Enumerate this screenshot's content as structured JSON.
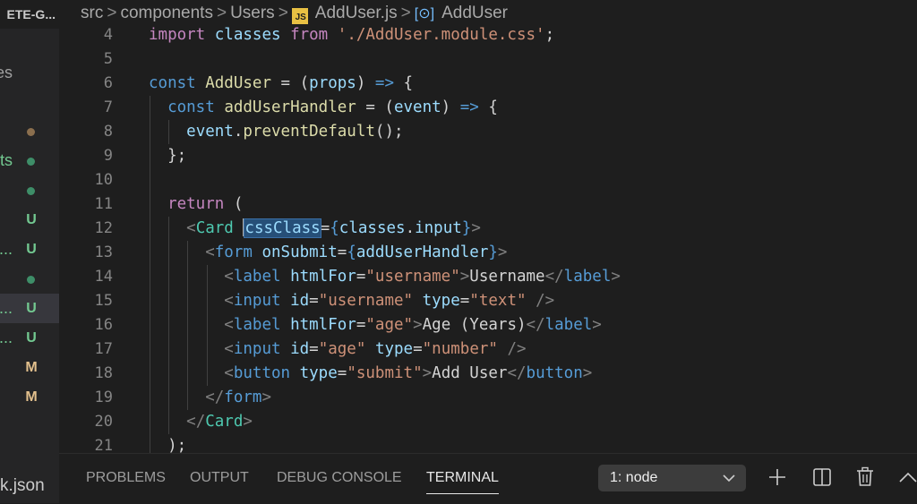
{
  "sidebar": {
    "title": "ETE-G...",
    "items": [
      {
        "name": "es",
        "badge": "",
        "dot": ""
      },
      {
        "name": "",
        "badge": "",
        "dot": "#8b6f4e"
      },
      {
        "name": "ts",
        "badge": "",
        "dot": "#3e8e68"
      },
      {
        "name": "",
        "badge": "",
        "dot": "#3e8e68"
      },
      {
        "name": "",
        "badge": "U",
        "dot": ""
      },
      {
        "name": "o...",
        "badge": "U",
        "dot": ""
      },
      {
        "name": "",
        "badge": "",
        "dot": "#3e8e68"
      },
      {
        "name": "r...",
        "badge": "U",
        "dot": ""
      },
      {
        "name": "r...",
        "badge": "U",
        "dot": ""
      },
      {
        "name": "",
        "badge": "M",
        "dot": ""
      },
      {
        "name": "",
        "badge": "M",
        "dot": ""
      }
    ],
    "bottom_item": "k.json"
  },
  "breadcrumb": {
    "segments": [
      "src",
      "components",
      "Users"
    ],
    "file": "AddUser.js",
    "file_icon": "JS",
    "symbol": "AddUser",
    "separator": ">"
  },
  "editor": {
    "lines": [
      {
        "n": "4",
        "indent": 0,
        "tokens": [
          [
            "kw",
            "import"
          ],
          [
            "pl",
            " "
          ],
          [
            "vr",
            "classes"
          ],
          [
            "pl",
            " "
          ],
          [
            "kw",
            "from"
          ],
          [
            "pl",
            " "
          ],
          [
            "st",
            "'./AddUser.module.css'"
          ],
          [
            "pl",
            ";"
          ]
        ]
      },
      {
        "n": "5",
        "indent": 0,
        "tokens": []
      },
      {
        "n": "6",
        "indent": 0,
        "tokens": [
          [
            "kb",
            "const"
          ],
          [
            "pl",
            " "
          ],
          [
            "fn",
            "AddUser"
          ],
          [
            "pl",
            " = ("
          ],
          [
            "vr",
            "props"
          ],
          [
            "pl",
            ") "
          ],
          [
            "kb",
            "=>"
          ],
          [
            "pl",
            " {"
          ]
        ]
      },
      {
        "n": "7",
        "indent": 1,
        "tokens": [
          [
            "pl",
            "  "
          ],
          [
            "kb",
            "const"
          ],
          [
            "pl",
            " "
          ],
          [
            "fn",
            "addUserHandler"
          ],
          [
            "pl",
            " = ("
          ],
          [
            "vr",
            "event"
          ],
          [
            "pl",
            ") "
          ],
          [
            "kb",
            "=>"
          ],
          [
            "pl",
            " {"
          ]
        ]
      },
      {
        "n": "8",
        "indent": 2,
        "tokens": [
          [
            "pl",
            "    "
          ],
          [
            "vr",
            "event"
          ],
          [
            "pl",
            "."
          ],
          [
            "fn",
            "preventDefault"
          ],
          [
            "pl",
            "();"
          ]
        ]
      },
      {
        "n": "9",
        "indent": 1,
        "tokens": [
          [
            "pl",
            "  };"
          ]
        ]
      },
      {
        "n": "10",
        "indent": 1,
        "tokens": []
      },
      {
        "n": "11",
        "indent": 1,
        "tokens": [
          [
            "pl",
            "  "
          ],
          [
            "kw",
            "return"
          ],
          [
            "pl",
            " ("
          ]
        ]
      },
      {
        "n": "12",
        "indent": 2,
        "tokens": [
          [
            "pl",
            "    "
          ],
          [
            "br",
            "<"
          ],
          [
            "cp",
            "Card"
          ],
          [
            "pl",
            " "
          ],
          [
            "cur",
            ""
          ],
          [
            "sel",
            "cssClass"
          ],
          [
            "pl",
            "="
          ],
          [
            "kb",
            "{"
          ],
          [
            "vr",
            "classes"
          ],
          [
            "pl",
            "."
          ],
          [
            "vr",
            "input"
          ],
          [
            "kb",
            "}"
          ],
          [
            "br",
            ">"
          ]
        ]
      },
      {
        "n": "13",
        "indent": 3,
        "tokens": [
          [
            "pl",
            "      "
          ],
          [
            "br",
            "<"
          ],
          [
            "tg",
            "form"
          ],
          [
            "pl",
            " "
          ],
          [
            "vr",
            "onSubmit"
          ],
          [
            "pl",
            "="
          ],
          [
            "kb",
            "{"
          ],
          [
            "vr",
            "addUserHandler"
          ],
          [
            "kb",
            "}"
          ],
          [
            "br",
            ">"
          ]
        ]
      },
      {
        "n": "14",
        "indent": 4,
        "tokens": [
          [
            "pl",
            "        "
          ],
          [
            "br",
            "<"
          ],
          [
            "tg",
            "label"
          ],
          [
            "pl",
            " "
          ],
          [
            "vr",
            "htmlFor"
          ],
          [
            "pl",
            "="
          ],
          [
            "st",
            "\"username\""
          ],
          [
            "br",
            ">"
          ],
          [
            "pl",
            "Username"
          ],
          [
            "br",
            "</"
          ],
          [
            "tg",
            "label"
          ],
          [
            "br",
            ">"
          ]
        ]
      },
      {
        "n": "15",
        "indent": 4,
        "tokens": [
          [
            "pl",
            "        "
          ],
          [
            "br",
            "<"
          ],
          [
            "tg",
            "input"
          ],
          [
            "pl",
            " "
          ],
          [
            "vr",
            "id"
          ],
          [
            "pl",
            "="
          ],
          [
            "st",
            "\"username\""
          ],
          [
            "pl",
            " "
          ],
          [
            "vr",
            "type"
          ],
          [
            "pl",
            "="
          ],
          [
            "st",
            "\"text\""
          ],
          [
            "pl",
            " "
          ],
          [
            "br",
            "/>"
          ]
        ]
      },
      {
        "n": "16",
        "indent": 4,
        "tokens": [
          [
            "pl",
            "        "
          ],
          [
            "br",
            "<"
          ],
          [
            "tg",
            "label"
          ],
          [
            "pl",
            " "
          ],
          [
            "vr",
            "htmlFor"
          ],
          [
            "pl",
            "="
          ],
          [
            "st",
            "\"age\""
          ],
          [
            "br",
            ">"
          ],
          [
            "pl",
            "Age (Years)"
          ],
          [
            "br",
            "</"
          ],
          [
            "tg",
            "label"
          ],
          [
            "br",
            ">"
          ]
        ]
      },
      {
        "n": "17",
        "indent": 4,
        "tokens": [
          [
            "pl",
            "        "
          ],
          [
            "br",
            "<"
          ],
          [
            "tg",
            "input"
          ],
          [
            "pl",
            " "
          ],
          [
            "vr",
            "id"
          ],
          [
            "pl",
            "="
          ],
          [
            "st",
            "\"age\""
          ],
          [
            "pl",
            " "
          ],
          [
            "vr",
            "type"
          ],
          [
            "pl",
            "="
          ],
          [
            "st",
            "\"number\""
          ],
          [
            "pl",
            " "
          ],
          [
            "br",
            "/>"
          ]
        ]
      },
      {
        "n": "18",
        "indent": 4,
        "tokens": [
          [
            "pl",
            "        "
          ],
          [
            "br",
            "<"
          ],
          [
            "tg",
            "button"
          ],
          [
            "pl",
            " "
          ],
          [
            "vr",
            "type"
          ],
          [
            "pl",
            "="
          ],
          [
            "st",
            "\"submit\""
          ],
          [
            "br",
            ">"
          ],
          [
            "pl",
            "Add User"
          ],
          [
            "br",
            "</"
          ],
          [
            "tg",
            "button"
          ],
          [
            "br",
            ">"
          ]
        ]
      },
      {
        "n": "19",
        "indent": 3,
        "tokens": [
          [
            "pl",
            "      "
          ],
          [
            "br",
            "</"
          ],
          [
            "tg",
            "form"
          ],
          [
            "br",
            ">"
          ]
        ]
      },
      {
        "n": "20",
        "indent": 2,
        "tokens": [
          [
            "pl",
            "    "
          ],
          [
            "br",
            "</"
          ],
          [
            "cp",
            "Card"
          ],
          [
            "br",
            ">"
          ]
        ]
      },
      {
        "n": "21",
        "indent": 1,
        "tokens": [
          [
            "pl",
            "  );"
          ]
        ]
      }
    ]
  },
  "panel": {
    "tabs": [
      "PROBLEMS",
      "OUTPUT",
      "DEBUG CONSOLE",
      "TERMINAL"
    ],
    "active_tab": "TERMINAL",
    "terminal_select": "1: node",
    "icons": [
      "plus-icon",
      "split-icon",
      "trash-icon",
      "chevron-up-icon"
    ]
  }
}
